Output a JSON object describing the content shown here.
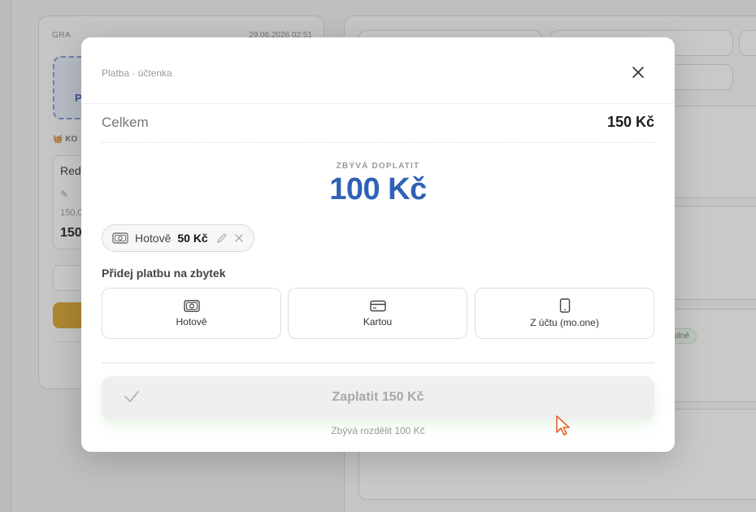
{
  "background": {
    "left_card": {
      "category": "GRA",
      "datetime": "29.06.2026 02:51",
      "dashed_letter": "P",
      "basket_label": "KO",
      "item_name": "Red",
      "item_price": "150,0",
      "item_total": "150"
    },
    "right_badge": "olné"
  },
  "modal": {
    "title": "Platba · účtenka",
    "total_label": "Celkem",
    "total_value": "150 Kč",
    "remaining_label": "ZBÝVÁ DOPLATIT",
    "remaining_value": "100 Kč",
    "payments": [
      {
        "method": "Hotově",
        "amount": "50 Kč"
      }
    ],
    "add_payment_label": "Přidej platbu na zbytek",
    "methods": [
      {
        "label": "Hotově",
        "icon": "cash-icon"
      },
      {
        "label": "Kartou",
        "icon": "card-icon"
      },
      {
        "label": "Z účtu (mo.one)",
        "icon": "phone-icon"
      }
    ],
    "pay_button_label": "Zaplatit 150 Kč",
    "hint": "Zbývá rozdělit 100 Kč"
  },
  "colors": {
    "accent_blue": "#2f62b6",
    "trash_yellow": "#d9a42a",
    "cursor_orange": "#e8602c"
  }
}
